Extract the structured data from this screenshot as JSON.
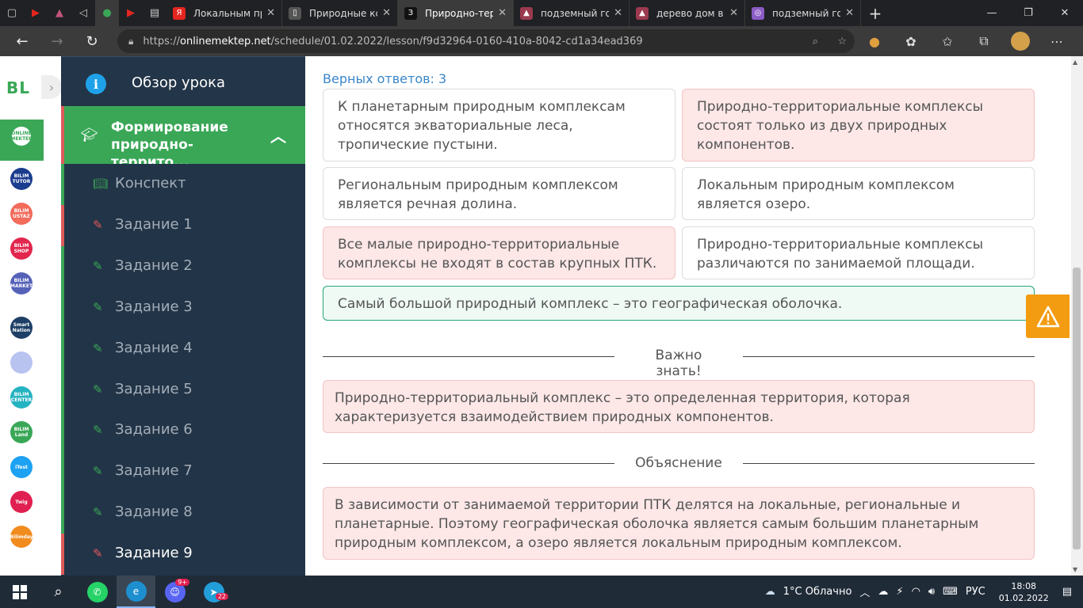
{
  "browser": {
    "tabs": [
      {
        "title": "Локальным пр",
        "icon": "yandex-icon",
        "color": "#e52620",
        "glyph": "Я",
        "active": false
      },
      {
        "title": "Природные кс",
        "icon": "document-icon",
        "color": "#555555",
        "glyph": "▯",
        "active": false
      },
      {
        "title": "Природно-тер",
        "icon": "znanija-icon",
        "color": "#111111",
        "glyph": "З",
        "active": true
      },
      {
        "title": "подземный го",
        "icon": "image-icon",
        "color": "#9b3a4f",
        "glyph": "▲",
        "active": false
      },
      {
        "title": "дерево дом в",
        "icon": "image-icon",
        "color": "#9b3a4f",
        "glyph": "▲",
        "active": false
      },
      {
        "title": "подземный го",
        "icon": "search-icon",
        "color": "#8b5cc4",
        "glyph": "◎",
        "active": false
      }
    ],
    "url_prefix": "https://",
    "url_host": "onlinemektep.net",
    "url_path": "/schedule/01.02.2022/lesson/f9d32964-0160-410a-8042-cd1a34ead369"
  },
  "apps": [
    {
      "name": "online-mektep",
      "label": "ONLINE MEKTEP",
      "color": "#3aa757"
    },
    {
      "name": "bilim-tutor",
      "label": "BILIM TUTOR",
      "color": "#1b3d8f"
    },
    {
      "name": "bilim-ustaz",
      "label": "BILIM USTAZ",
      "color": "#f26b5b"
    },
    {
      "name": "bilim-shop",
      "label": "BILIM SHOP",
      "color": "#e2264d"
    },
    {
      "name": "bilim-market",
      "label": "BILIM MARKET",
      "color": "#5562b8"
    },
    {
      "name": "smart-nation",
      "label": "Smart Nation",
      "color": "#1e3f66"
    },
    {
      "name": "bilim-docs",
      "label": "",
      "color": "#b9c3f0"
    },
    {
      "name": "bilim-center",
      "label": "BILIM CENTER",
      "color": "#26b3c1"
    },
    {
      "name": "bilim-land",
      "label": "BILIM Land",
      "color": "#3aa757"
    },
    {
      "name": "itest",
      "label": "iTest",
      "color": "#1da1f2"
    },
    {
      "name": "twig",
      "label": "Twig",
      "color": "#e02050"
    },
    {
      "name": "bilimday",
      "label": "Bilimday",
      "color": "#f28b1e"
    }
  ],
  "sidebar": {
    "overview": "Обзор урока",
    "section": "Формирование природно-террито...",
    "items": [
      {
        "label": "Конспект",
        "icon": "book-icon",
        "strip": "#3aa757",
        "current": false
      },
      {
        "label": "Задание 1",
        "icon": "edit-icon",
        "strip": "#e05a5a",
        "current": false
      },
      {
        "label": "Задание 2",
        "icon": "edit-icon",
        "strip": "#3aa757",
        "current": false
      },
      {
        "label": "Задание 3",
        "icon": "edit-icon",
        "strip": "#3aa757",
        "current": false
      },
      {
        "label": "Задание 4",
        "icon": "edit-icon",
        "strip": "#3aa757",
        "current": false
      },
      {
        "label": "Задание 5",
        "icon": "edit-icon",
        "strip": "#3aa757",
        "current": false
      },
      {
        "label": "Задание 6",
        "icon": "edit-icon",
        "strip": "#3aa757",
        "current": false
      },
      {
        "label": "Задание 7",
        "icon": "edit-icon",
        "strip": "#3aa757",
        "current": false
      },
      {
        "label": "Задание 8",
        "icon": "edit-icon",
        "strip": "#3aa757",
        "current": false
      },
      {
        "label": "Задание 9",
        "icon": "edit-icon",
        "strip": "#e05a5a",
        "current": true
      }
    ]
  },
  "main": {
    "score": "Верных ответов: 3",
    "answers": [
      {
        "text": "К планетарным природным комплексам относятся экваториальные леса, тропические пустыни.",
        "state": "neutral"
      },
      {
        "text": "Природно-территориальные комплексы состоят только из двух природных компонентов.",
        "state": "wrong"
      },
      {
        "text": "Региональным природным комплексом является речная долина.",
        "state": "neutral"
      },
      {
        "text": "Локальным природным комплексом является озеро.",
        "state": "neutral"
      },
      {
        "text": "Все малые природно-территориальные комплексы не входят в состав крупных ПТК.",
        "state": "wrong"
      },
      {
        "text": "Природно-территориальные комплексы различаются по занимаемой площади.",
        "state": "neutral"
      },
      {
        "text": "Самый большой природный комплекс – это географическая оболочка.",
        "state": "right"
      }
    ],
    "important_title": "Важно знать!",
    "important_text": "Природно-территориальный комплекс – это определенная территория, которая характеризуется взаимодействием природных компонентов.",
    "explanation_title": "Объяснение",
    "explanation_text": "В зависимости от занимаемой территории ПТК делятся на локальные, региональные и планетарные. Поэтому географическая оболочка является самым большим планетарным природным комплексом, а озеро является локальным природным комплексом."
  },
  "taskbar": {
    "weather": "1°C  Облачно",
    "lang": "РУС",
    "time": "18:08",
    "date": "01.02.2022",
    "discord_badge": "9+",
    "telegram_badge": "22"
  }
}
